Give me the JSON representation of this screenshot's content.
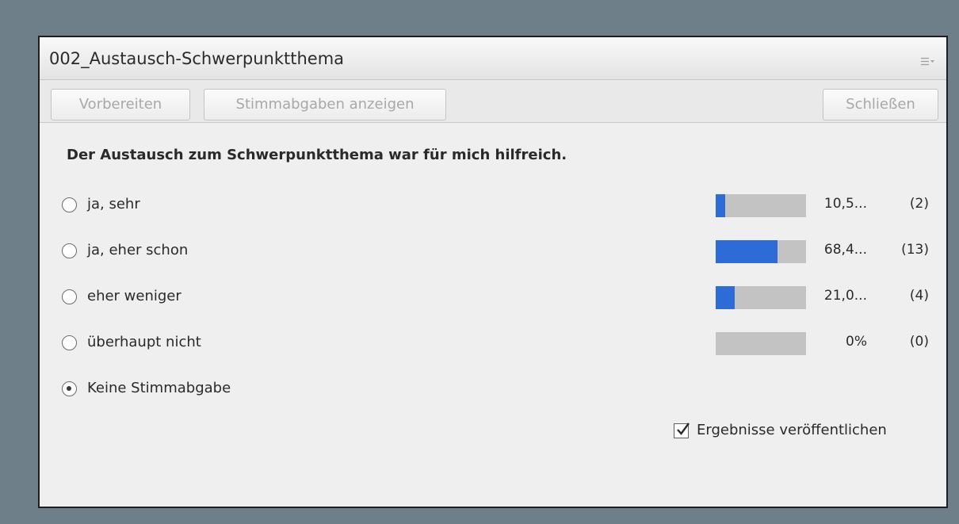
{
  "pod": {
    "title": "002_Austausch-Schwerpunktthema",
    "menu_icon": "hamburger-menu-icon"
  },
  "toolbar": {
    "prepare_label": "Vorbereiten",
    "show_votes_label": "Stimmabgaben anzeigen",
    "close_label": "Schließen"
  },
  "poll": {
    "question": "Der Austausch zum Schwerpunktthema war für mich hilfreich.",
    "options": [
      {
        "label": "ja, sehr",
        "percent_text": "10,5...",
        "count_text": "(2)",
        "fraction": 0.105,
        "selected": false
      },
      {
        "label": "ja, eher schon",
        "percent_text": "68,4...",
        "count_text": "(13)",
        "fraction": 0.684,
        "selected": false
      },
      {
        "label": "eher weniger",
        "percent_text": "21,0...",
        "count_text": "(4)",
        "fraction": 0.21,
        "selected": false
      },
      {
        "label": "überhaupt nicht",
        "percent_text": "0%",
        "count_text": "(0)",
        "fraction": 0,
        "selected": false
      }
    ],
    "no_vote": {
      "label": "Keine Stimmabgabe",
      "selected": true
    },
    "publish_results": {
      "label": "Ergebnisse veröffentlichen",
      "checked": true
    }
  },
  "colors": {
    "bar_fill": "#2d6bd6",
    "bar_track": "#c3c3c3",
    "background": "#6f7f89"
  }
}
